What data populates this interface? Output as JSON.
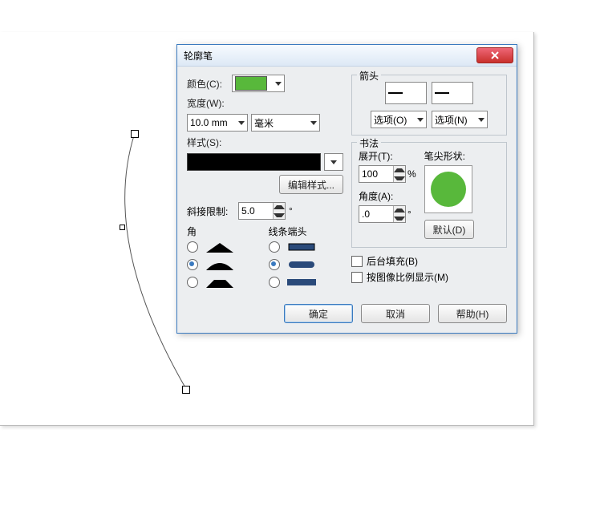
{
  "dialog": {
    "title": "轮廓笔",
    "color_label": "颜色(C):",
    "width_label": "宽度(W):",
    "width_value": "10.0 mm",
    "unit_value": "毫米",
    "style_label": "样式(S):",
    "edit_style_btn": "编辑样式...",
    "miter_label": "斜接限制:",
    "miter_value": "5.0",
    "corner_label": "角",
    "cap_label": "线条端头",
    "arrow_label": "箭头",
    "option_left": "选项(O)",
    "option_right": "选项(N)",
    "calligraphy_label": "书法",
    "stretch_label": "展开(T):",
    "stretch_value": "100",
    "stretch_pct": "%",
    "angle_label": "角度(A):",
    "angle_value": ".0",
    "angle_deg": "°",
    "pen_shape_label": "笔尖形状:",
    "default_btn": "默认(D)",
    "bg_fill_label": "后台填充(B)",
    "scale_label": "按图像比例显示(M)",
    "ok_btn": "确定",
    "cancel_btn": "取消",
    "help_btn": "帮助(H)"
  }
}
